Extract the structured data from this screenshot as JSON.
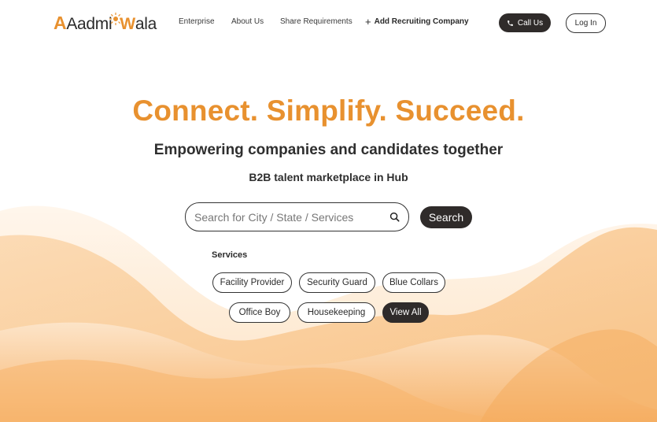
{
  "brand": {
    "logo_text_pre": "Aadmi",
    "logo_text_post": "ala",
    "logo_w": "W"
  },
  "nav": {
    "enterprise": "Enterprise",
    "about": "About Us",
    "share": "Share Requirements",
    "add_company": "Add Recruiting Company",
    "call": "Call Us",
    "login": "Log In"
  },
  "hero": {
    "title": "Connect. Simplify. Succeed.",
    "subtitle": "Empowering companies and candidates together",
    "tagline": "B2B talent marketplace in Hub"
  },
  "search": {
    "placeholder": "Search for City / State / Services",
    "button": "Search"
  },
  "services": {
    "label": "Services",
    "chips": [
      "Facility Provider",
      "Security Guard",
      "Blue Collars",
      "Office Boy",
      "Housekeeping",
      "View All"
    ]
  },
  "colors": {
    "accent": "#e8912f",
    "dark": "#2f2b2a",
    "wave": "#f8c48a"
  }
}
